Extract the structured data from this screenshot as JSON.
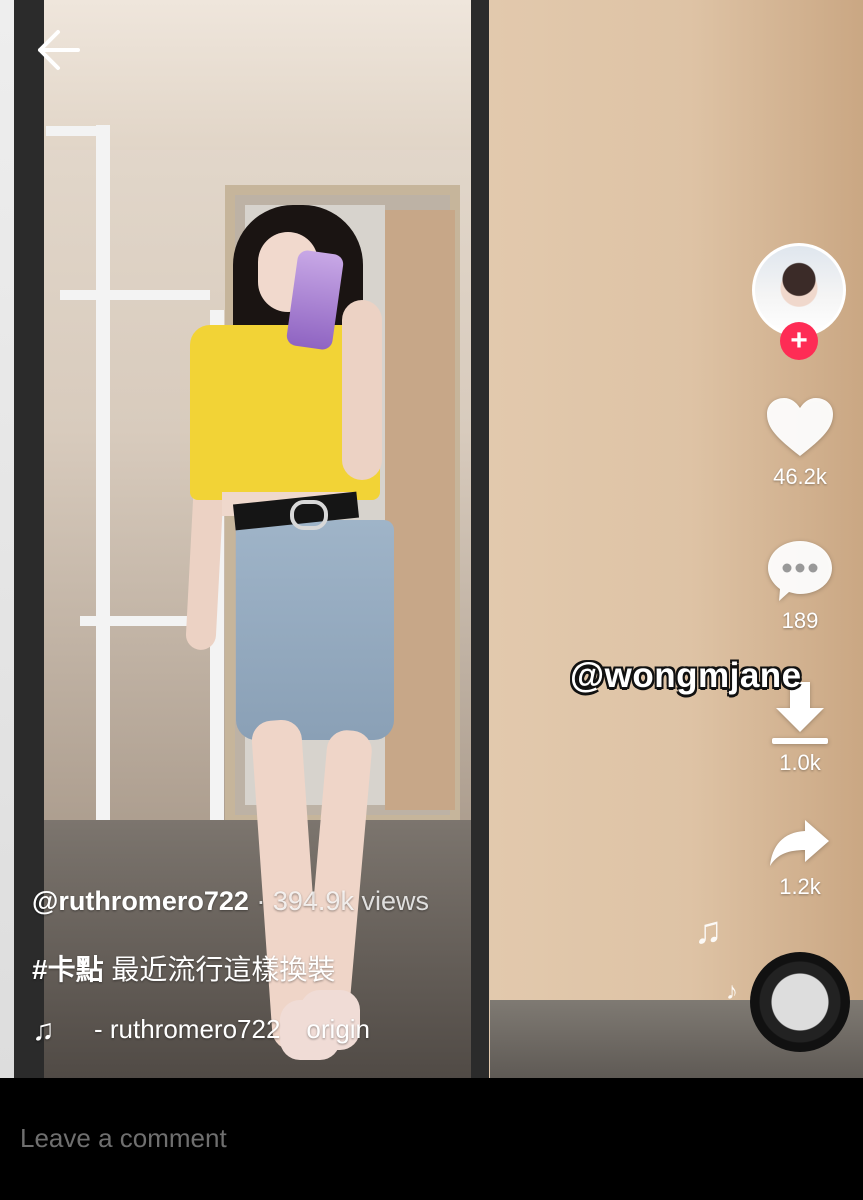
{
  "header": {
    "back_icon": "arrow-left-icon"
  },
  "creator": {
    "avatar_icon": "profile-avatar",
    "follow_icon": "plus-icon",
    "follow_color": "#fe2c55"
  },
  "actions": {
    "like": {
      "icon": "heart-icon",
      "count": "46.2k"
    },
    "comment": {
      "icon": "comment-bubble-icon",
      "count": "189"
    },
    "download": {
      "icon": "download-icon",
      "count": "1.0k"
    },
    "share": {
      "icon": "share-arrow-icon",
      "count": "1.2k"
    }
  },
  "watermark": "@wongmjane",
  "post": {
    "author": "@ruthromero722",
    "views": " · 394.9k views",
    "hashtag": "#卡點",
    "caption": " 最近流行這樣換裝",
    "music_icon": "music-note-icon",
    "music_author": "- ruthromero722",
    "music_title": "origin"
  },
  "comment": {
    "placeholder": "Leave a comment"
  }
}
